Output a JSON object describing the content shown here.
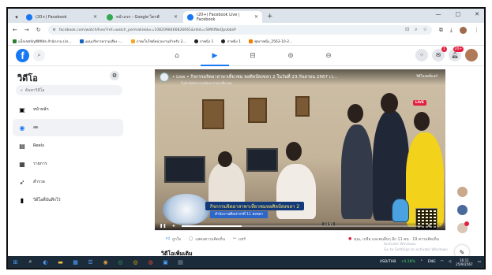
{
  "browser": {
    "tabs": [
      {
        "label": "(20+) Facebook",
        "color": "#1877f2",
        "active": false
      },
      {
        "label": "หน้าแรก - Google ไดรฟ์",
        "color": "#34a853",
        "active": false
      },
      {
        "label": "(20+) Facebook Live | Facebook",
        "color": "#1877f2",
        "active": true
      }
    ],
    "url": "facebook.com/watch/live/?ref=watch_permalink&v=1082098466826661&rdid=cSMhfNoQpvbbsP",
    "bookmarks": [
      "แอ็กเซสบัญชีดิจิทัล สำนักงาน (ss...",
      "แผนบริหารความเสี่ยง -...",
      "ภาพเว็บไซต์หน่วยงานสำหรับ 2...",
      "ภาพนิ่ง 1",
      "ภาพนิ่ง 1",
      "ชุดภาพนิ่ง_2563-10-2..."
    ],
    "window_controls": [
      "—",
      "□",
      "✕"
    ]
  },
  "facebook": {
    "logo": "f",
    "nav_icons": [
      "home-icon",
      "watch-icon",
      "marketplace-icon",
      "groups-icon",
      "gaming-icon"
    ],
    "notifications_badge": "1",
    "messenger_badge": "20+"
  },
  "sidebar": {
    "title": "วิดีโอ",
    "search_placeholder": "ค้นหาวิดีโอ",
    "items": [
      {
        "label": "หน้าหลัก",
        "icon": "tv-icon",
        "active": false
      },
      {
        "label": "สด",
        "icon": "live-icon",
        "active": true
      },
      {
        "label": "Reels",
        "icon": "reels-icon",
        "active": false
      },
      {
        "label": "รายการ",
        "icon": "shows-icon",
        "active": false
      },
      {
        "label": "สำรวจ",
        "icon": "explore-icon",
        "active": false
      },
      {
        "label": "วิดีโอที่บันทึกไว้",
        "icon": "bookmark-icon",
        "active": false
      }
    ]
  },
  "video": {
    "title": "• Live • กิจกรรมจิตอาสาพาเที่ยวชม หอศิลป์สงขลา 2 ในวันที่ 23 กันยายน 2567 เว...",
    "channel": "วิดีโอสดที่แชร์",
    "subtitle": "ในหัวข้อกิจกรรมจิตอาสาพาเที่ยวชม",
    "live_label": "LIVE",
    "banner_title": "กิจกรรมจิตอาสาพาเที่ยวชมหอศิลป์สงขลา 2",
    "banner_sub": "สำนักงานศิลปากรที่ 11 สงขลา",
    "timestamp": "23:55",
    "progress": 0.25
  },
  "reactions": {
    "like": "ถูกใจ",
    "comment": "แสดงความคิดเห็น",
    "share": "แชร์",
    "count": "คุณ, เกลือ และคนอื่นๆ อีก 11 คน · 19 ความคิดเห็น"
  },
  "more_section": "วิดีโอเพิ่มเติม",
  "activate": {
    "line1": "Activate Windows",
    "line2": "Go to Settings to activate Windows."
  },
  "taskbar": {
    "currency": "USD/THB",
    "change": "+0.28%",
    "lang": "ENG",
    "time": "16:11",
    "date": "25/9/2567"
  }
}
